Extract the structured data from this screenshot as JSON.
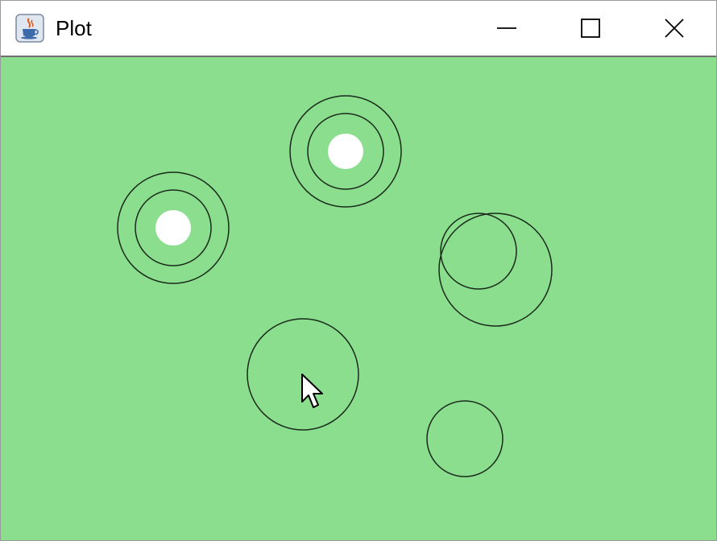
{
  "window": {
    "title": "Plot",
    "icon": "java-cup-icon",
    "controls": [
      "minimize-icon",
      "maximize-icon",
      "close-icon"
    ]
  },
  "canvas": {
    "background_color": "#8ade8e",
    "ring_color": "#1a2a1a",
    "dot_color": "#ffffff"
  },
  "pointer": {
    "icon": "arrow-cursor-icon"
  }
}
